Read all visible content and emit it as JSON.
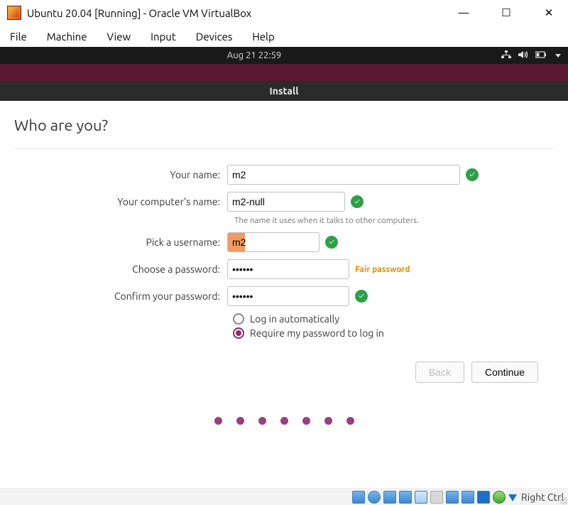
{
  "vbox": {
    "title": "Ubuntu 20.04 [Running] - Oracle VM VirtualBox",
    "menu": [
      "File",
      "Machine",
      "View",
      "Input",
      "Devices",
      "Help"
    ],
    "host_key": "Right Ctrl"
  },
  "topbar": {
    "clock": "Aug 21  22:59"
  },
  "installer": {
    "window_title": "Install",
    "heading": "Who are you?",
    "labels": {
      "name": "Your name:",
      "computer": "Your computer's name:",
      "computer_hint": "The name it uses when it talks to other computers.",
      "username": "Pick a username:",
      "password": "Choose a password:",
      "confirm": "Confirm your password:"
    },
    "values": {
      "name": "m2",
      "computer": "m2-null",
      "username": "m2",
      "password": "••••••",
      "confirm": "••••••"
    },
    "pw_strength": "Fair password",
    "login_options": {
      "auto": "Log in automatically",
      "require": "Require my password to log in",
      "selected": "require"
    },
    "buttons": {
      "back": "Back",
      "continue": "Continue"
    },
    "progress_total": 7
  }
}
